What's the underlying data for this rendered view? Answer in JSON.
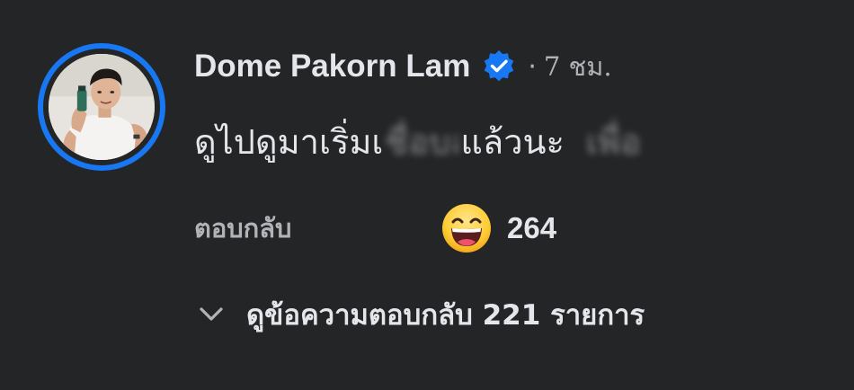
{
  "comment": {
    "author": "Dome Pakorn Lam",
    "verified_icon": "verified-badge-icon",
    "separator": "·",
    "timestamp": "7 ชม.",
    "text_before": "ดูไปดูมาเริ่มเ",
    "text_blurred_1": "ชื่อบล",
    "text_after": "แล้วนะ",
    "text_blurred_2": "เพื่อ",
    "reply_label": "ตอบกลับ",
    "reaction": {
      "icon": "haha-emoji-icon",
      "count": "264"
    },
    "view_replies_icon": "chevron-down-icon",
    "view_replies_label": "ดูข้อความตอบกลับ 221 รายการ"
  },
  "colors": {
    "background": "#242526",
    "primary_text": "#e4e6eb",
    "secondary_text": "#b0b3b8",
    "accent": "#1877f2"
  }
}
